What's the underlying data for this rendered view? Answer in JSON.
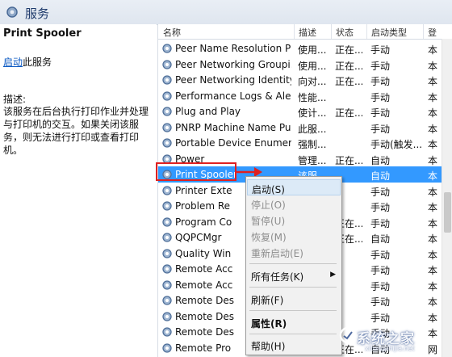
{
  "window": {
    "title": "服务"
  },
  "left_pane": {
    "service_name": "Print Spooler",
    "start_link": "启动",
    "start_suffix": "此服务",
    "desc_label": "描述:",
    "desc_text": "该服务在后台执行打印作业并处理与打印机的交互。如果关闭该服务，则无法进行打印或查看打印机。"
  },
  "columns": {
    "name": "名称",
    "desc": "描述",
    "status": "状态",
    "type": "启动类型",
    "logon": "登"
  },
  "rows": [
    {
      "name": "Peer Name Resolution Pr...",
      "desc": "使用...",
      "status": "正在...",
      "type": "手动",
      "logon": "本"
    },
    {
      "name": "Peer Networking Groupi...",
      "desc": "使用...",
      "status": "正在...",
      "type": "手动",
      "logon": "本"
    },
    {
      "name": "Peer Networking Identity...",
      "desc": "向对...",
      "status": "正在...",
      "type": "手动",
      "logon": "本"
    },
    {
      "name": "Performance Logs & Aler...",
      "desc": "性能...",
      "status": "",
      "type": "手动",
      "logon": "本"
    },
    {
      "name": "Plug and Play",
      "desc": "使计...",
      "status": "正在...",
      "type": "手动",
      "logon": "本"
    },
    {
      "name": "PNRP Machine Name Pu...",
      "desc": "此服...",
      "status": "",
      "type": "手动",
      "logon": "本"
    },
    {
      "name": "Portable Device Enumera...",
      "desc": "强制...",
      "status": "",
      "type": "手动(触发...",
      "logon": "本"
    },
    {
      "name": "Power",
      "desc": "管理...",
      "status": "正在...",
      "type": "自动",
      "logon": "本"
    },
    {
      "name": "Print Spooler",
      "desc": "该服...",
      "status": "",
      "type": "自动",
      "logon": "本"
    },
    {
      "name": "Printer Exte",
      "desc": "",
      "status": "",
      "type": "手动",
      "logon": "本"
    },
    {
      "name": "Problem Re",
      "desc": "",
      "status": "",
      "type": "手动",
      "logon": "本"
    },
    {
      "name": "Program Co",
      "desc": "",
      "status": "正在...",
      "type": "手动",
      "logon": "本"
    },
    {
      "name": "QQPCMgr",
      "desc": "",
      "status": "正在...",
      "type": "自动",
      "logon": "本"
    },
    {
      "name": "Quality Win",
      "desc": "",
      "status": "",
      "type": "手动",
      "logon": "本"
    },
    {
      "name": "Remote Acc",
      "desc": "",
      "status": "",
      "type": "手动",
      "logon": "本"
    },
    {
      "name": "Remote Acc",
      "desc": "",
      "status": "",
      "type": "手动",
      "logon": "本"
    },
    {
      "name": "Remote Des",
      "desc": "",
      "status": "",
      "type": "手动",
      "logon": "本"
    },
    {
      "name": "Remote Des",
      "desc": "",
      "status": "",
      "type": "手动",
      "logon": "本"
    },
    {
      "name": "Remote Des",
      "desc": "",
      "status": "",
      "type": "手动",
      "logon": "本"
    },
    {
      "name": "Remote Pro",
      "desc": "",
      "status": "正在...",
      "type": "自动",
      "logon": "网"
    }
  ],
  "context_menu": {
    "start": "启动(S)",
    "stop": "停止(O)",
    "pause": "暂停(U)",
    "resume": "恢复(M)",
    "restart": "重新启动(E)",
    "all_tasks": "所有任务(K)",
    "refresh": "刷新(F)",
    "properties": "属性(R)",
    "help": "帮助(H)"
  },
  "watermark": {
    "text": "系统之家",
    "url": "xitongzhijia.net"
  },
  "colors": {
    "selection": "#3399ff",
    "highlight_box": "#e02020",
    "link": "#0a58c2"
  }
}
